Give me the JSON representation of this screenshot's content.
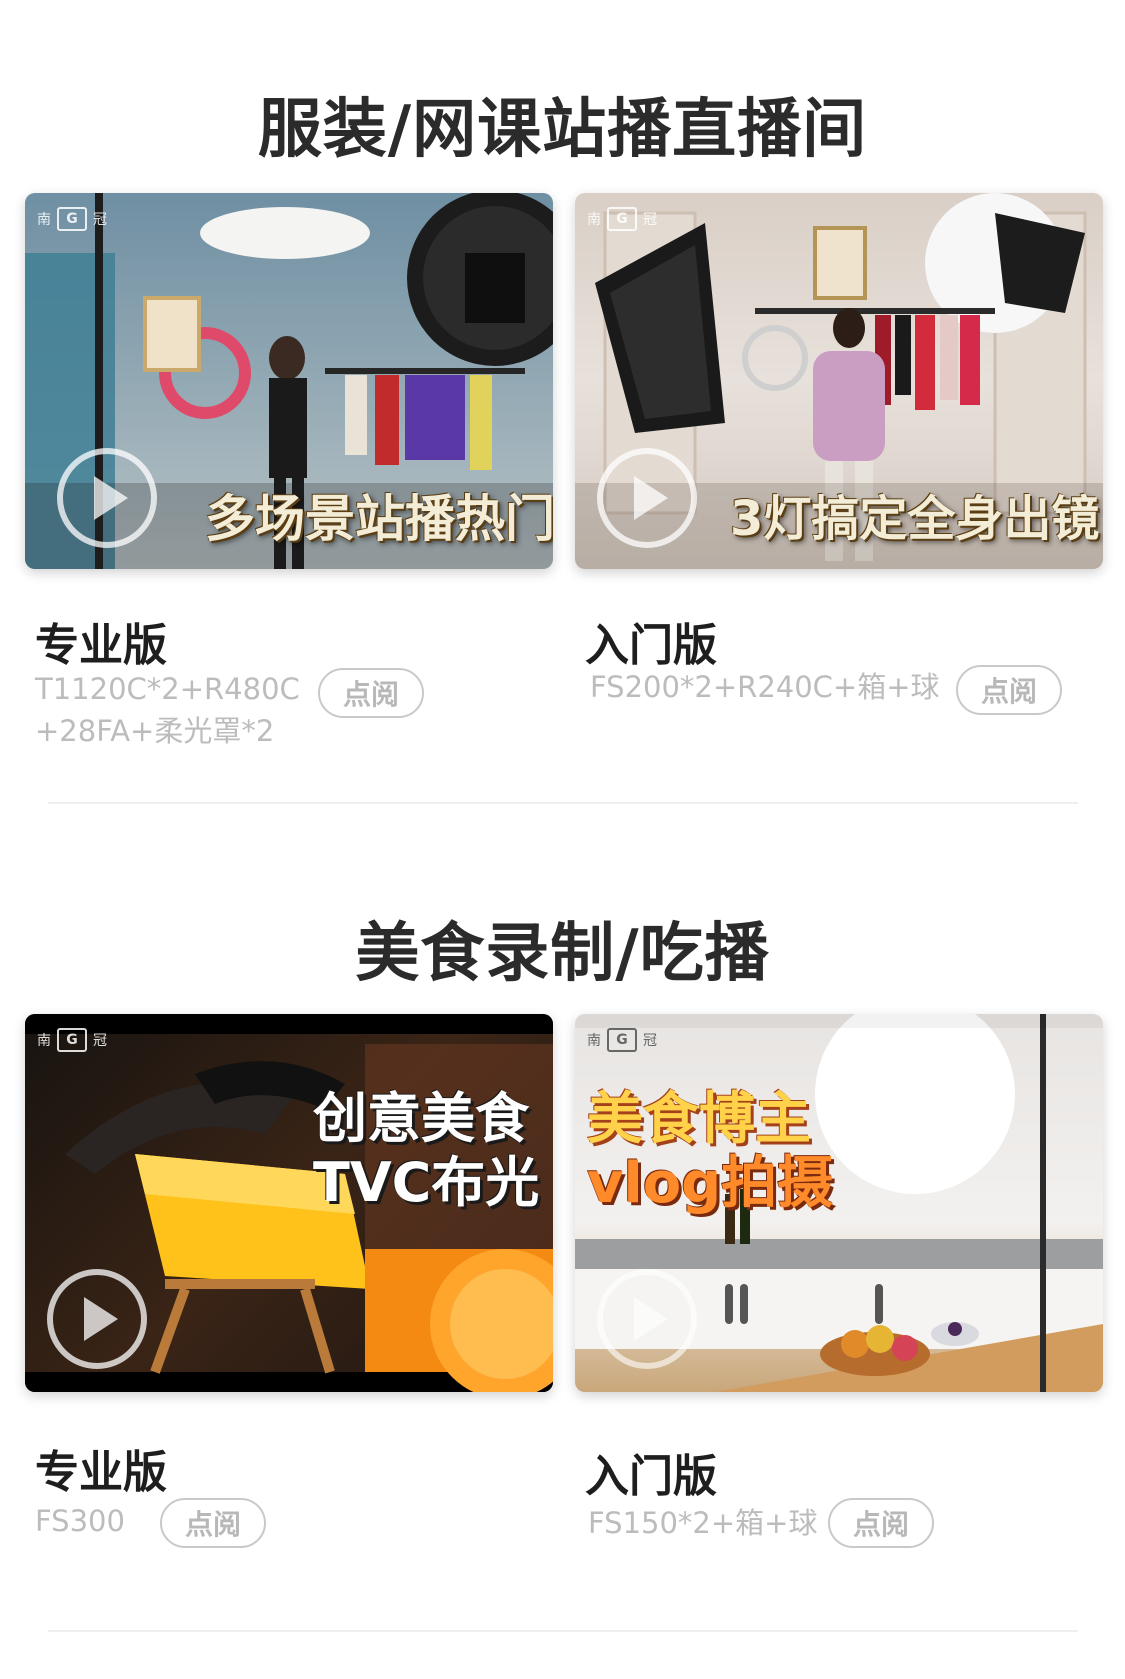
{
  "sections": [
    {
      "title": "服装/网课站播直播间",
      "cards": [
        {
          "overlay": "多场景站播热门",
          "brand": [
            "南",
            "G",
            "冠"
          ],
          "edition": "专业版",
          "spec_line1": "T1120C*2+R480C",
          "spec_line2": "+28FA+柔光罩*2",
          "button": "点阅"
        },
        {
          "overlay": "3灯搞定全身出镜",
          "brand": [
            "南",
            "G",
            "冠"
          ],
          "edition": "入门版",
          "spec_line1": "FS200*2+R240C+箱+球",
          "button": "点阅"
        }
      ]
    },
    {
      "title": "美食录制/吃播",
      "cards": [
        {
          "overlay_line1": "创意美食",
          "overlay_line2": "TVC布光",
          "brand": [
            "南",
            "G",
            "冠"
          ],
          "edition": "专业版",
          "spec_line1": "FS300",
          "button": "点阅"
        },
        {
          "overlay_line1": "美食博主",
          "overlay_line2": "vlog拍摄",
          "brand": [
            "南",
            "G",
            "冠"
          ],
          "edition": "入门版",
          "spec_line1": "FS150*2+箱+球",
          "button": "点阅"
        }
      ]
    }
  ],
  "colors": {
    "title": "#2b2b2b",
    "spec": "#bcbcbc",
    "button_border": "#c9c9c9",
    "overlay_yellow": "#ffd24a",
    "overlay_orange": "#ff8a2a"
  },
  "icons": {
    "play": "play-icon",
    "logo": "brand-logo-icon"
  }
}
